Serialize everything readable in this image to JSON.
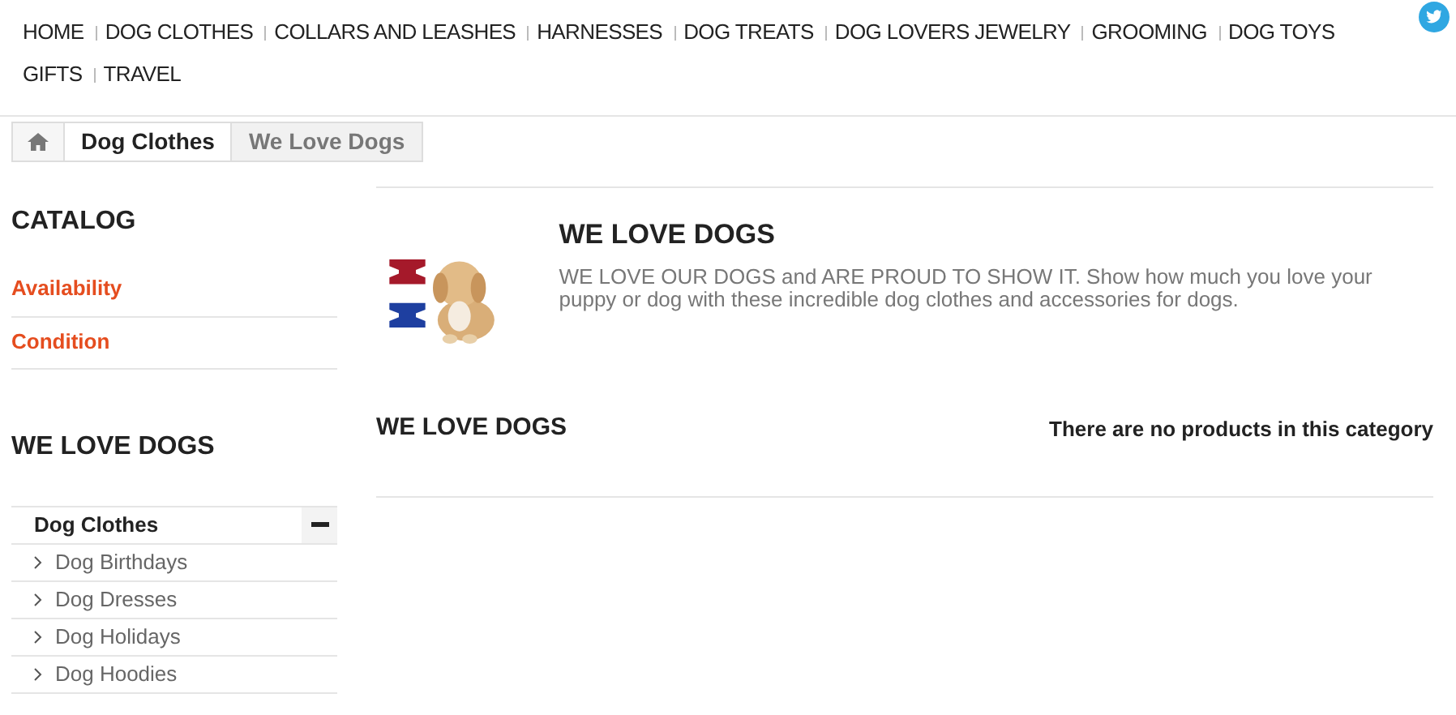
{
  "nav": {
    "items": [
      {
        "label": "HOME"
      },
      {
        "label": "DOG CLOTHES"
      },
      {
        "label": "COLLARS AND LEASHES"
      },
      {
        "label": "HARNESSES"
      },
      {
        "label": "DOG TREATS"
      },
      {
        "label": "DOG LOVERS JEWELRY"
      },
      {
        "label": "GROOMING"
      },
      {
        "label": "DOG TOYS"
      },
      {
        "label": "GIFTS"
      },
      {
        "label": "TRAVEL"
      }
    ]
  },
  "breadcrumb": [
    {
      "label": "Dog Clothes",
      "current": false
    },
    {
      "label": "We Love Dogs",
      "current": true
    }
  ],
  "sidebar": {
    "catalog_title": "CATALOG",
    "filters": [
      "Availability",
      "Condition"
    ],
    "tree_title": "WE LOVE DOGS",
    "tree": [
      {
        "label": "Dog Clothes",
        "expanded": true,
        "children": [
          {
            "label": "Dog Birthdays"
          },
          {
            "label": "Dog Dresses"
          },
          {
            "label": "Dog Holidays"
          },
          {
            "label": "Dog Hoodies"
          }
        ]
      }
    ]
  },
  "category": {
    "title": "WE LOVE DOGS",
    "description": "WE LOVE OUR DOGS and ARE PROUD TO SHOW IT. Show how much you love your puppy or dog with these incredible dog clothes and accessories for dogs.",
    "heading": "WE LOVE DOGS",
    "empty_message": "There are no products in this category"
  }
}
